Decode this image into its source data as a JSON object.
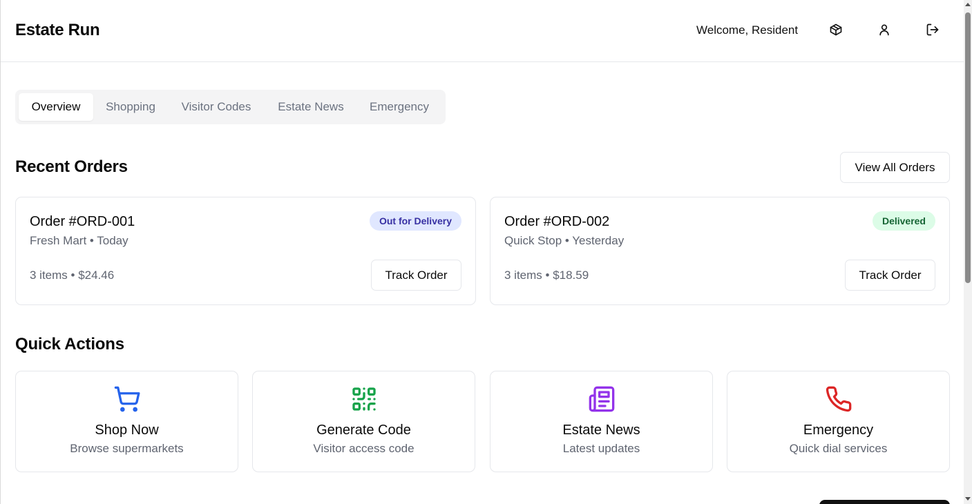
{
  "header": {
    "app_title": "Estate Run",
    "welcome_text": "Welcome, Resident",
    "icons": [
      "package-icon",
      "user-icon",
      "logout-icon"
    ]
  },
  "tabs": [
    {
      "label": "Overview",
      "active": true
    },
    {
      "label": "Shopping",
      "active": false
    },
    {
      "label": "Visitor Codes",
      "active": false
    },
    {
      "label": "Estate News",
      "active": false
    },
    {
      "label": "Emergency",
      "active": false
    }
  ],
  "recent_orders": {
    "title": "Recent Orders",
    "view_all_label": "View All Orders",
    "orders": [
      {
        "title": "Order #ORD-001",
        "meta": "Fresh Mart • Today",
        "summary": "3 items • $24.46",
        "status": "Out for Delivery",
        "status_color": "#3730a3",
        "action_label": "Track Order"
      },
      {
        "title": "Order #ORD-002",
        "meta": "Quick Stop • Yesterday",
        "summary": "3 items • $18.59",
        "status": "Delivered",
        "status_color": "#166534",
        "action_label": "Track Order"
      }
    ]
  },
  "quick_actions": {
    "title": "Quick Actions",
    "items": [
      {
        "title": "Shop Now",
        "subtitle": "Browse supermarkets",
        "icon": "shopping-cart-icon",
        "color": "#2563eb"
      },
      {
        "title": "Generate Code",
        "subtitle": "Visitor access code",
        "icon": "qr-code-icon",
        "color": "#16a34a"
      },
      {
        "title": "Estate News",
        "subtitle": "Latest updates",
        "icon": "newspaper-icon",
        "color": "#9333ea"
      },
      {
        "title": "Emergency",
        "subtitle": "Quick dial services",
        "icon": "phone-icon",
        "color": "#dc2626"
      }
    ]
  }
}
